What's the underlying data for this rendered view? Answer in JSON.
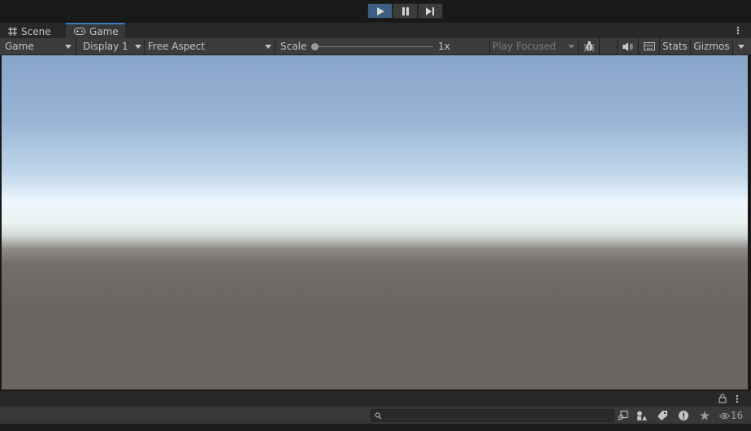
{
  "play_controls": {
    "play": "play",
    "pause": "pause",
    "step": "step"
  },
  "tabs": [
    {
      "label": "Scene",
      "icon": "grid-icon",
      "selected": false
    },
    {
      "label": "Game",
      "icon": "gamepad-icon",
      "selected": true
    }
  ],
  "game_toolbar": {
    "view_mode": "Game",
    "display": "Display 1",
    "aspect": "Free Aspect",
    "scale_label": "Scale",
    "scale_value_text": "1x",
    "scale_fraction": 0.0,
    "play_mode": "Play Focused",
    "stats_label": "Stats",
    "gizmos_label": "Gizmos"
  },
  "bottom_panel": {
    "search_placeholder": "",
    "visible_count": "16"
  },
  "colors": {
    "accent_tab": "#3a79bb",
    "play_active": "#3d5e82",
    "toolbar_bg": "#3c3c3c"
  }
}
